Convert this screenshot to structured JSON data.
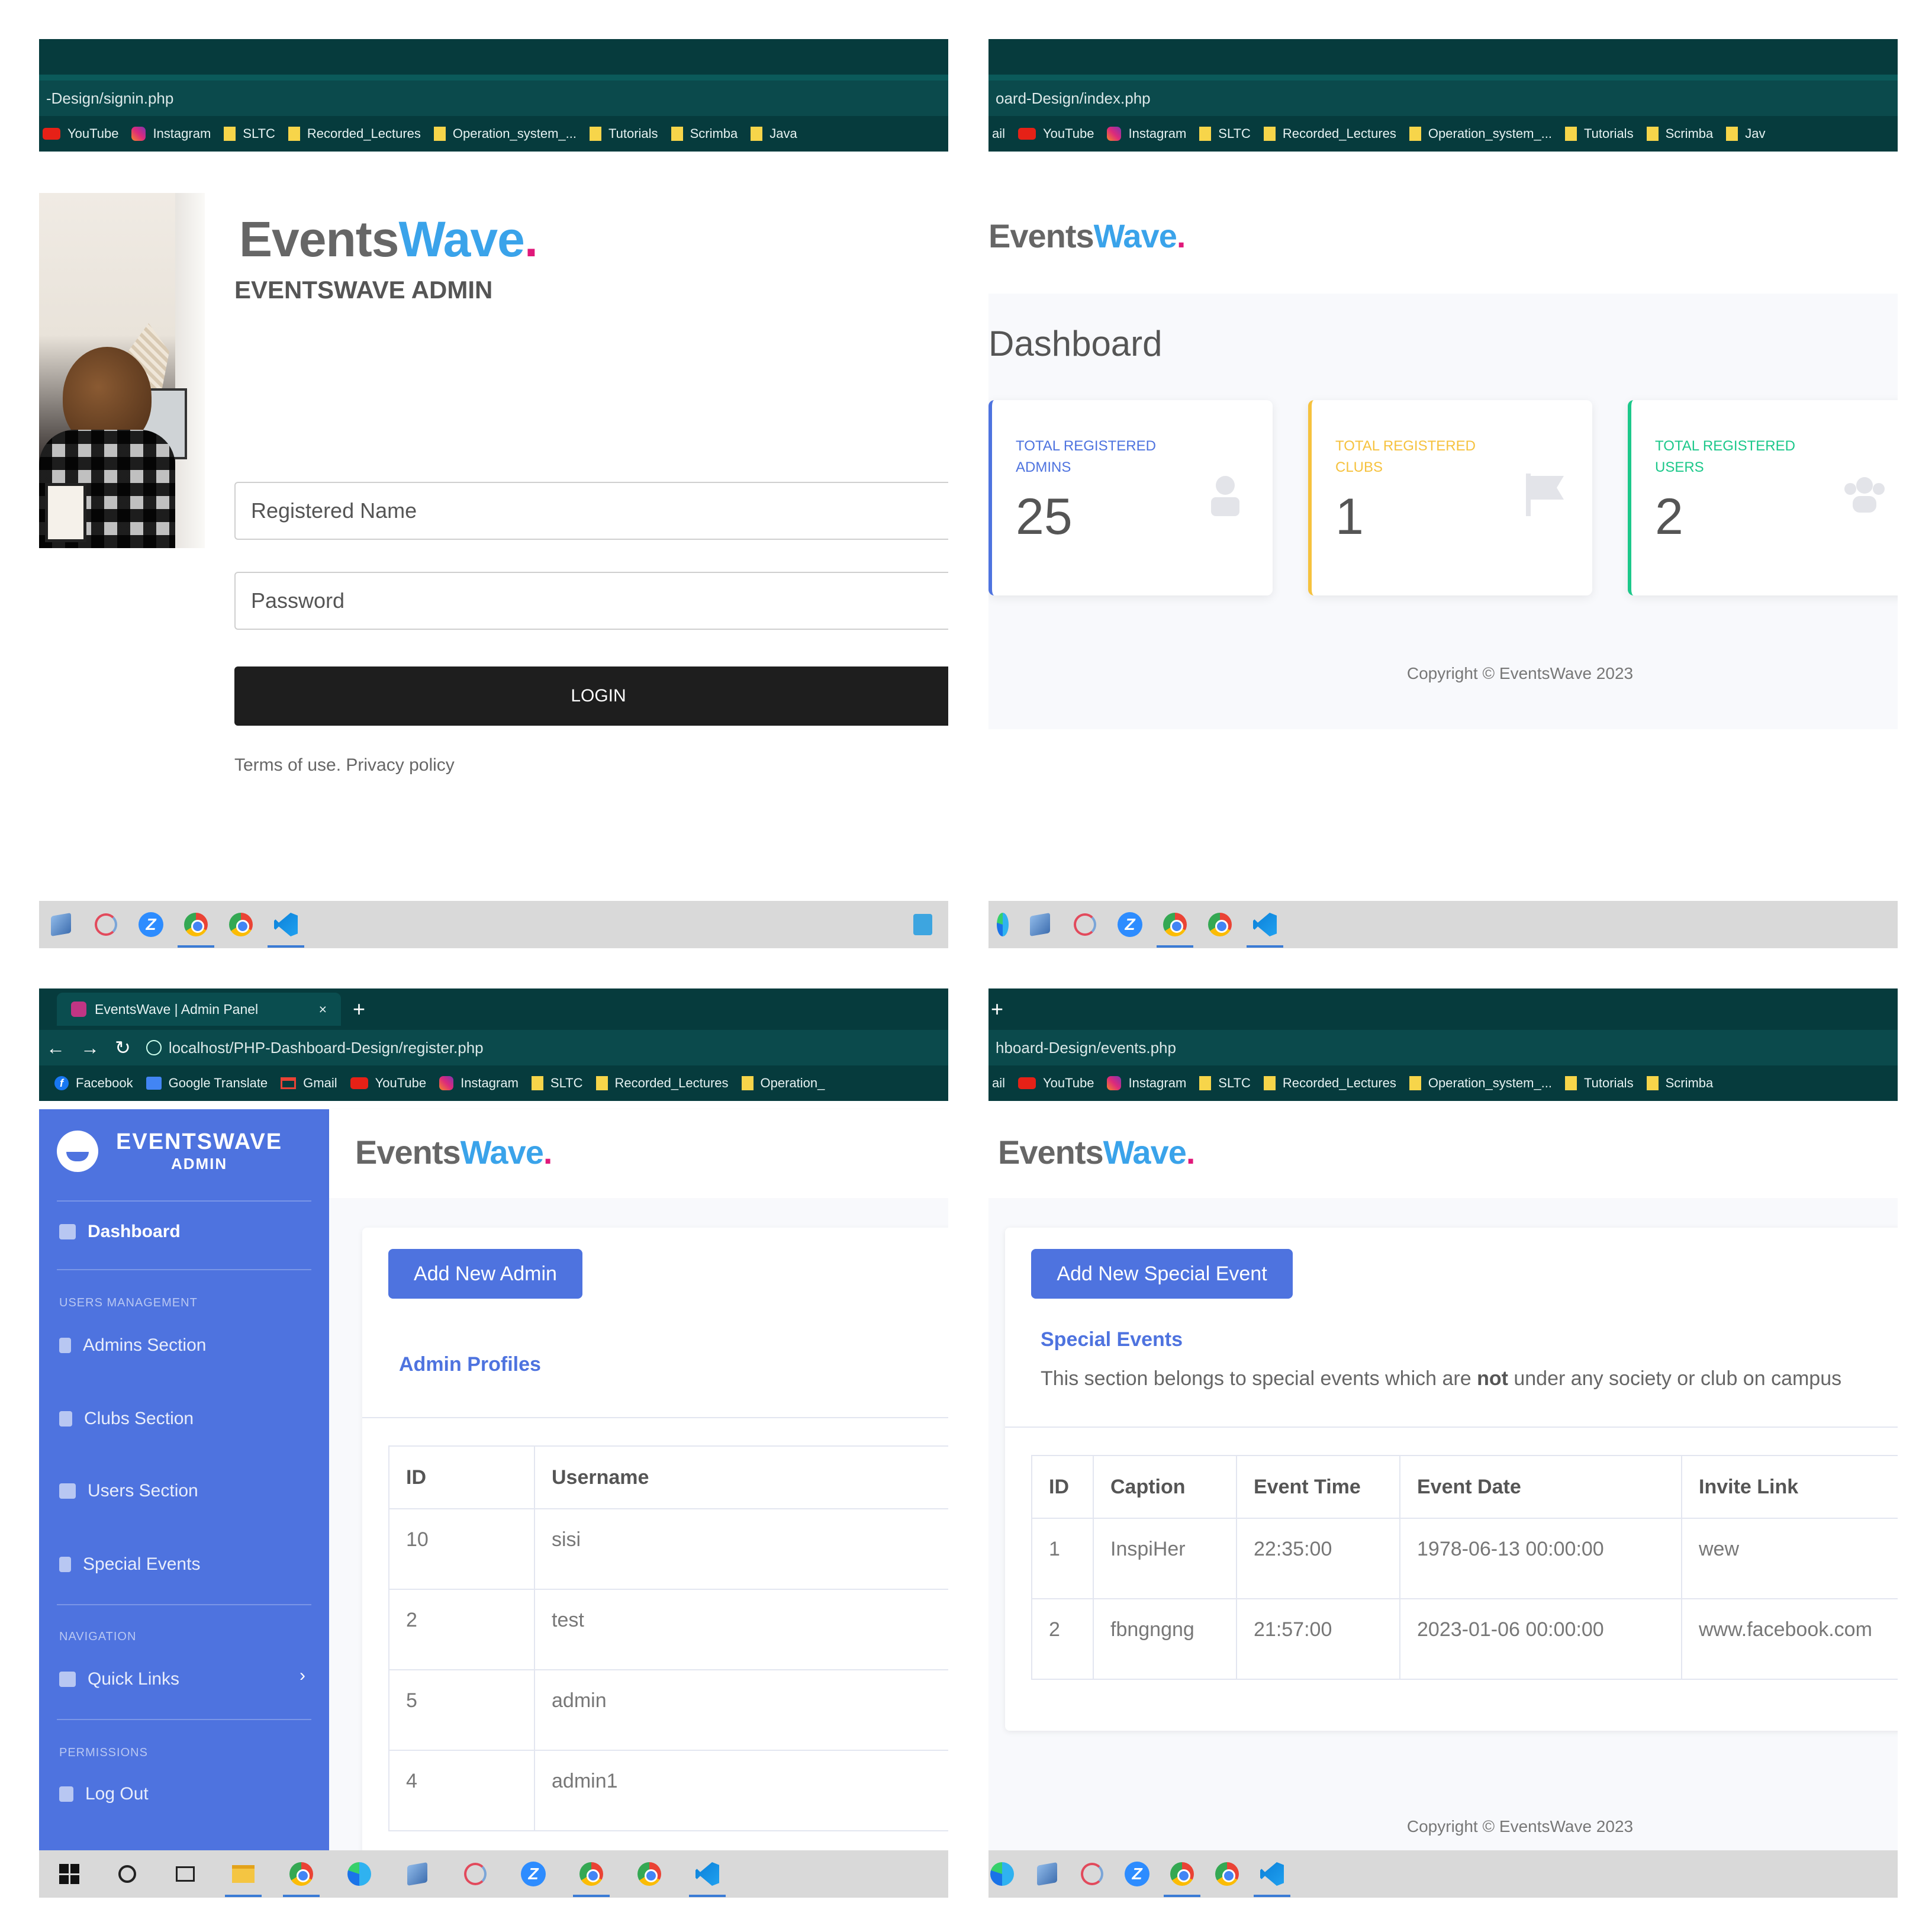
{
  "bookmarks": {
    "facebook": "Facebook",
    "google_translate": "Google Translate",
    "gmail": "Gmail",
    "gmail_short": "ail",
    "youtube": "YouTube",
    "instagram": "Instagram",
    "sltc": "SLTC",
    "recorded_lectures": "Recorded_Lectures",
    "operation_system": "Operation_system_...",
    "operation_short": "Operation_",
    "tutorials": "Tutorials",
    "scrimba": "Scrimba",
    "java": "Java",
    "java_short": "Jav"
  },
  "logo": {
    "part1": "Events",
    "part2": "Wave",
    "dot": "."
  },
  "colors": {
    "brand_blue": "#4e73df",
    "logo_blue": "#3aa3ea",
    "logo_dot": "#e0197a",
    "browser_chrome": "#063b3d"
  },
  "panel_signin": {
    "url": "-Design/signin.php",
    "title": "EVENTSWAVE ADMIN",
    "name_placeholder": "Registered Name",
    "password_placeholder": "Password",
    "login_label": "LOGIN",
    "terms": "Terms of use. Privacy policy"
  },
  "panel_dashboard": {
    "url": "oard-Design/index.php",
    "heading": "Dashboard",
    "cards": [
      {
        "label": "TOTAL REGISTERED ADMINS",
        "value": "25",
        "color": "#4e73df",
        "icon": "user-secret-icon"
      },
      {
        "label": "TOTAL REGISTERED CLUBS",
        "value": "1",
        "color": "#f6c23e",
        "icon": "flag-icon"
      },
      {
        "label": "TOTAL REGISTERED USERS",
        "value": "2",
        "color": "#1cc88a",
        "icon": "users-icon"
      }
    ],
    "copyright": "Copyright © EventsWave 2023"
  },
  "panel_register": {
    "tab_title": "EventsWave | Admin Panel",
    "tab_close": "×",
    "new_tab": "+",
    "url": "localhost/PHP-Dashboard-Design/register.php",
    "sidebar": {
      "brand_line1": "EVENTSWAVE",
      "brand_line2": "ADMIN",
      "dashboard": "Dashboard",
      "users_management": "USERS MANAGEMENT",
      "admins": "Admins Section",
      "clubs": "Clubs Section",
      "users": "Users Section",
      "special": "Special Events",
      "navigation": "NAVIGATION",
      "quick_links": "Quick Links",
      "permissions": "PERMISSIONS",
      "logout": "Log Out"
    },
    "add_button": "Add New Admin",
    "section_title": "Admin Profiles",
    "table": {
      "headers": [
        "ID",
        "Username"
      ],
      "rows": [
        [
          "10",
          "sisi"
        ],
        [
          "2",
          "test"
        ],
        [
          "5",
          "admin"
        ],
        [
          "4",
          "admin1"
        ]
      ]
    }
  },
  "panel_events": {
    "new_tab": "+",
    "url": "hboard-Design/events.php",
    "add_button": "Add New Special Event",
    "section_title": "Special Events",
    "desc_before": "This section belongs to special events which are ",
    "desc_bold": "not",
    "desc_after": " under any society or club on campus",
    "table": {
      "headers": [
        "ID",
        "Caption",
        "Event Time",
        "Event Date",
        "Invite Link"
      ],
      "rows": [
        [
          "1",
          "InspiHer",
          "22:35:00",
          "1978-06-13 00:00:00",
          "wew"
        ],
        [
          "2",
          "fbngngng",
          "21:57:00",
          "2023-01-06 00:00:00",
          "www.facebook.com"
        ]
      ]
    },
    "copyright": "Copyright © EventsWave 2023"
  }
}
